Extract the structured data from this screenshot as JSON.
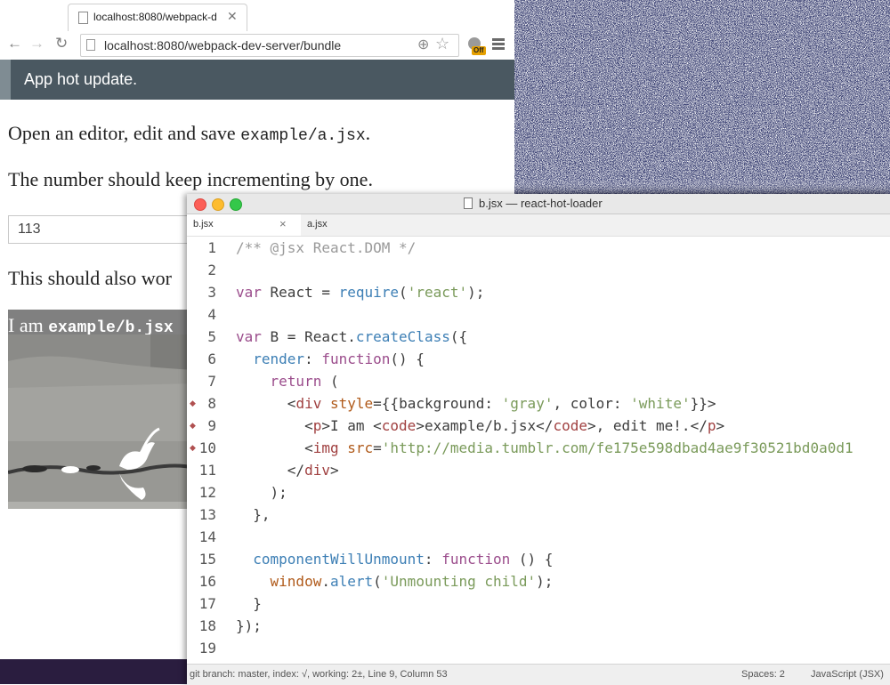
{
  "browser": {
    "tab_title": "localhost:8080/webpack-d",
    "url": "localhost:8080/webpack-dev-server/bundle",
    "extension_badge": "Off",
    "banner": "App hot update.",
    "paragraph1_prefix": "Open an editor, edit and save ",
    "paragraph1_code": "example/a.jsx",
    "paragraph1_suffix": ".",
    "paragraph2": "The number should keep incrementing by one.",
    "counter_value": "113",
    "paragraph3": "This should also wor",
    "gray_caption_prefix": "I am ",
    "gray_caption_code": "example/b.jsx"
  },
  "editor": {
    "window_title": "b.jsx — react-hot-loader",
    "tabs": [
      "b.jsx",
      "a.jsx"
    ],
    "lines": [
      "/** @jsx React.DOM */",
      "",
      "var React = require('react');",
      "",
      "var B = React.createClass({",
      "  render: function() {",
      "    return (",
      "      <div style={{background: 'gray', color: 'white'}}>",
      "        <p>I am <code>example/b.jsx</code>, edit me!.</p>",
      "        <img src='http://media.tumblr.com/fe175e598dbad4ae9f30521bd0a0d1",
      "      </div>",
      "    );",
      "  },",
      "",
      "  componentWillUnmount: function () {",
      "    window.alert('Unmounting child');",
      "  }",
      "});",
      ""
    ],
    "line_numbers": [
      "1",
      "2",
      "3",
      "4",
      "5",
      "6",
      "7",
      "8",
      "9",
      "10",
      "11",
      "12",
      "13",
      "14",
      "15",
      "16",
      "17",
      "18",
      "19"
    ],
    "modified_lines": [
      8,
      9,
      10
    ],
    "status_left": "git branch: master, index: √, working: 2±, Line 9, Column 53",
    "status_spaces": "Spaces: 2",
    "status_syntax": "JavaScript (JSX)"
  },
  "colors": {
    "banner_bg": "#4a5861",
    "traffic_red": "#fc5f57",
    "traffic_yellow": "#fdbc2e",
    "traffic_green": "#34c84a",
    "keyword": "#9b4d8c",
    "string": "#7a9a5a",
    "tag": "#a04040",
    "comment": "#9a9a9a"
  },
  "icons": {
    "back": "arrow-left-icon",
    "forward": "arrow-right-icon",
    "reload": "reload-icon",
    "zoom": "magnifier-icon",
    "star": "star-icon",
    "menu": "hamburger-menu-icon"
  }
}
